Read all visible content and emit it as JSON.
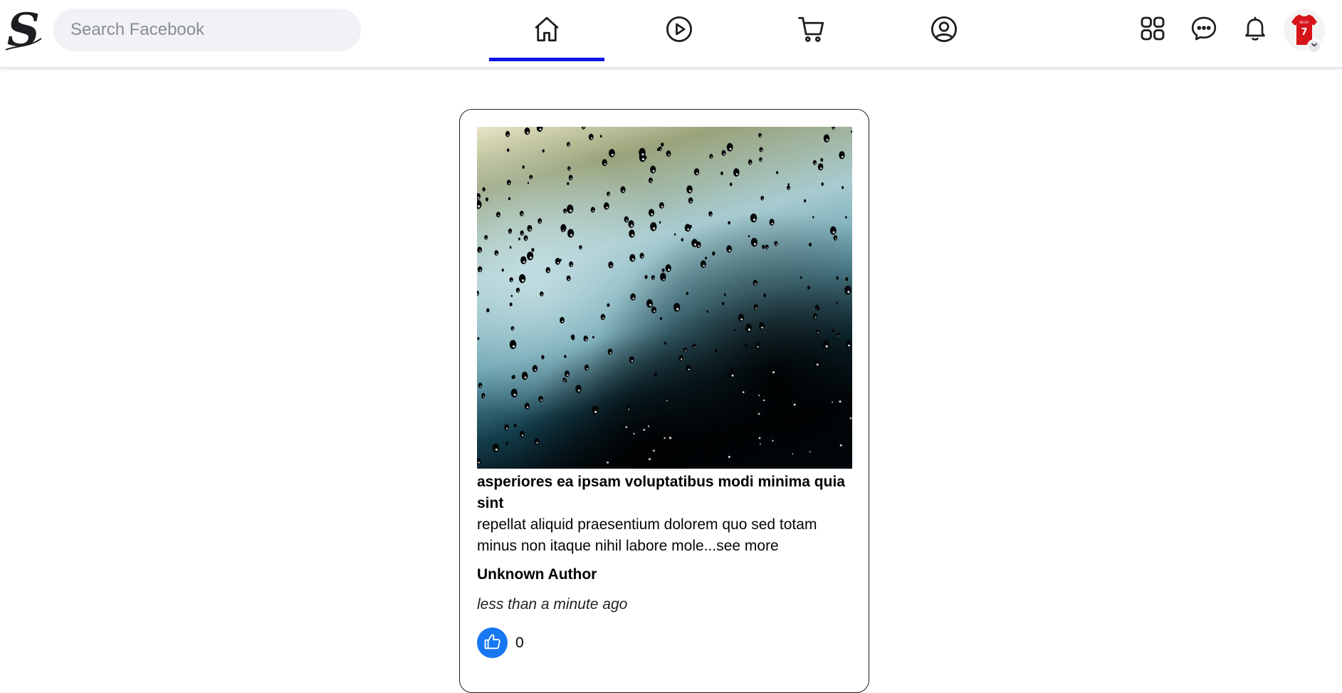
{
  "header": {
    "logo_letter": "S",
    "search": {
      "placeholder": "Search Facebook",
      "value": ""
    },
    "nav_tabs": [
      {
        "name": "home",
        "icon": "home-icon",
        "active": true
      },
      {
        "name": "watch",
        "icon": "play-circle-icon",
        "active": false
      },
      {
        "name": "marketplace",
        "icon": "cart-icon",
        "active": false
      },
      {
        "name": "profile",
        "icon": "user-circle-icon",
        "active": false
      }
    ],
    "right_icons": [
      "menu-grid-icon",
      "messenger-icon",
      "bell-icon"
    ],
    "avatar": {
      "jersey_number": "7",
      "jersey_name": "BECKY"
    },
    "active_indicator_color": "#0a14e6"
  },
  "post": {
    "title": "asperiores ea ipsam voluptatibus modi minima quia sint",
    "body": "repellat aliquid praesentium dolorem quo sed totam minus non itaque nihil labore mole...",
    "see_more": "see more",
    "author": "Unknown Author",
    "time": "less than a minute ago",
    "likes": "0",
    "like_button_color": "#1877f2"
  }
}
